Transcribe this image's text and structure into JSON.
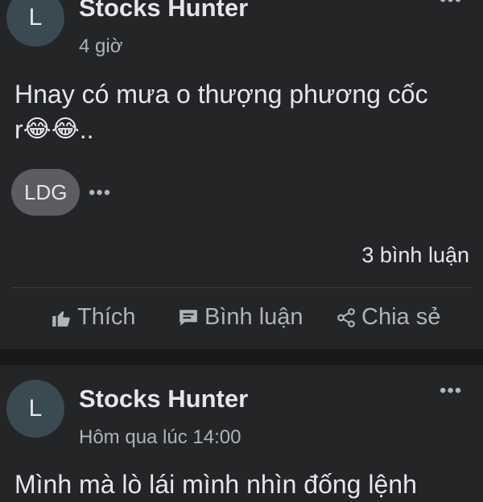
{
  "post1": {
    "avatar_letter": "L",
    "author": "Stocks Hunter",
    "time": "4 giờ",
    "content_line1": "Hnay có mưa o thượng phương cốc",
    "content_line2_prefix": "r",
    "content_line2_suffix": "..",
    "emoji": "😂",
    "tag": "LDG",
    "more": "•••",
    "comment_count": "3 bình luận",
    "actions": {
      "like": "Thích",
      "comment": "Bình luận",
      "share": "Chia sẻ"
    }
  },
  "post2": {
    "avatar_letter": "L",
    "author": "Stocks Hunter",
    "time": "Hôm qua lúc 14:00",
    "more": "•••",
    "content_partial": "Mình mà lò lái mình nhìn đống lệnh"
  },
  "colors": {
    "background": "#242526",
    "separator": "#18191a",
    "text_primary": "#e4e6eb",
    "text_secondary": "#b0b3b8",
    "tag_bg": "#5b5d61",
    "avatar_bg": "#3a4a52"
  }
}
